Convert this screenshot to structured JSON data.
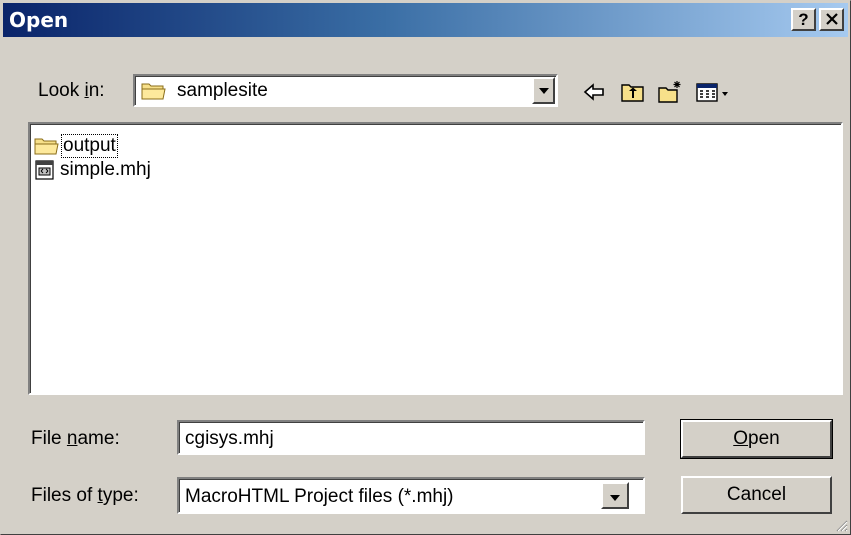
{
  "dialog": {
    "title": "Open",
    "help_label": "?",
    "close_label": "✕"
  },
  "look_in": {
    "label_pre": "Look ",
    "label_accel": "i",
    "label_post": "n:",
    "value": "samplesite"
  },
  "toolbar": {
    "back_icon": "back-arrow-icon",
    "up_icon": "up-folder-icon",
    "new_folder_icon": "new-folder-icon",
    "view_menu_icon": "view-menu-icon"
  },
  "files": [
    {
      "name": "output",
      "icon": "folder-icon",
      "focused": true
    },
    {
      "name": "simple.mhj",
      "icon": "project-file-icon",
      "focused": false
    }
  ],
  "file_name": {
    "label_pre": "File ",
    "label_accel": "n",
    "label_post": "ame:",
    "value": "cgisys.mhj"
  },
  "file_type": {
    "label_pre": "Files of ",
    "label_accel": "t",
    "label_post": "ype:",
    "value": "MacroHTML Project files (*.mhj)"
  },
  "buttons": {
    "open_accel": "O",
    "open_rest": "pen",
    "cancel": "Cancel"
  },
  "colors": {
    "titlebar_start": "#0a246a",
    "titlebar_end": "#a6caf0",
    "face": "#d4d0c8"
  }
}
